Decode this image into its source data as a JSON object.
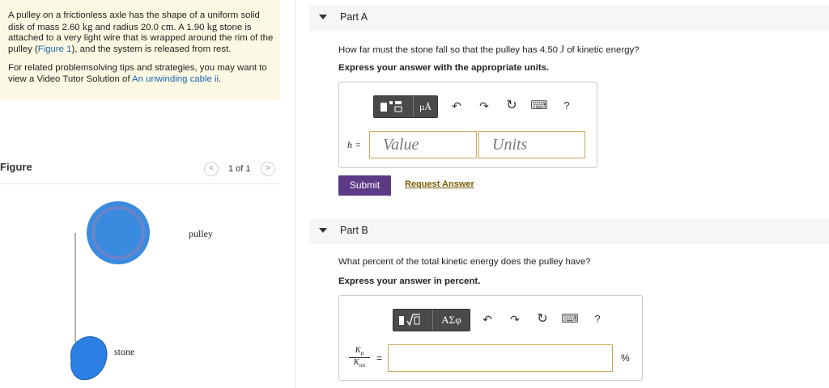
{
  "problem": {
    "para1_a": "A pulley on a frictionless axle has the shape of a uniform solid disk of mass 2.60 ",
    "unit_kg_1": "kg",
    "para1_b": " and radius 20.0 ",
    "unit_cm": "cm",
    "para1_c": ". A 1.90 ",
    "unit_kg_2": "kg",
    "para1_d": " stone is attached to a very light wire that is wrapped around the rim of the pulley (",
    "figure_link": "Figure 1",
    "para1_e": "), and the system is released from rest.",
    "para2_a": "For related problemsolving tips and strategies, you may want to view a Video Tutor Solution of ",
    "video_link": "An unwinding cable ii",
    "para2_b": "."
  },
  "figure": {
    "title": "Figure",
    "pager_prev": "<",
    "pager_text": "1 of 1",
    "pager_next": ">",
    "pulley_label": "pulley",
    "stone_label": "stone",
    "colors": {
      "disk_fill": "#3a8be0",
      "disk_ring": "#6a83c9",
      "stone_fill": "#2b7fe3",
      "wire": "#666666"
    }
  },
  "partA": {
    "title": "Part A",
    "question_a": "How far must the stone fall so that the pulley has 4.50 ",
    "unit_J": "J",
    "question_b": " of kinetic energy?",
    "instruction": "Express your answer with the appropriate units.",
    "toolbar": {
      "templates_icon": "templates-icon",
      "units_label": "μÅ",
      "undo": "↶",
      "redo": "↷",
      "reset": "↻",
      "keyboard": "⌨",
      "help": "?"
    },
    "var_label": "h =",
    "value_placeholder": "Value",
    "units_placeholder": "Units",
    "submit_label": "Submit",
    "request_label": "Request Answer"
  },
  "partB": {
    "title": "Part B",
    "question": "What percent of the total kinetic energy does the pulley have?",
    "instruction": "Express your answer in percent.",
    "toolbar": {
      "math_icon": "sqrt-templates-icon",
      "greek_label": "ΑΣφ",
      "undo": "↶",
      "redo": "↷",
      "reset": "↻",
      "keyboard": "⌨",
      "help": "?"
    },
    "frac_num": "K",
    "frac_num_sub": "p",
    "frac_den": "K",
    "frac_den_sub": "tot",
    "equals": "=",
    "unit_percent": "%"
  }
}
